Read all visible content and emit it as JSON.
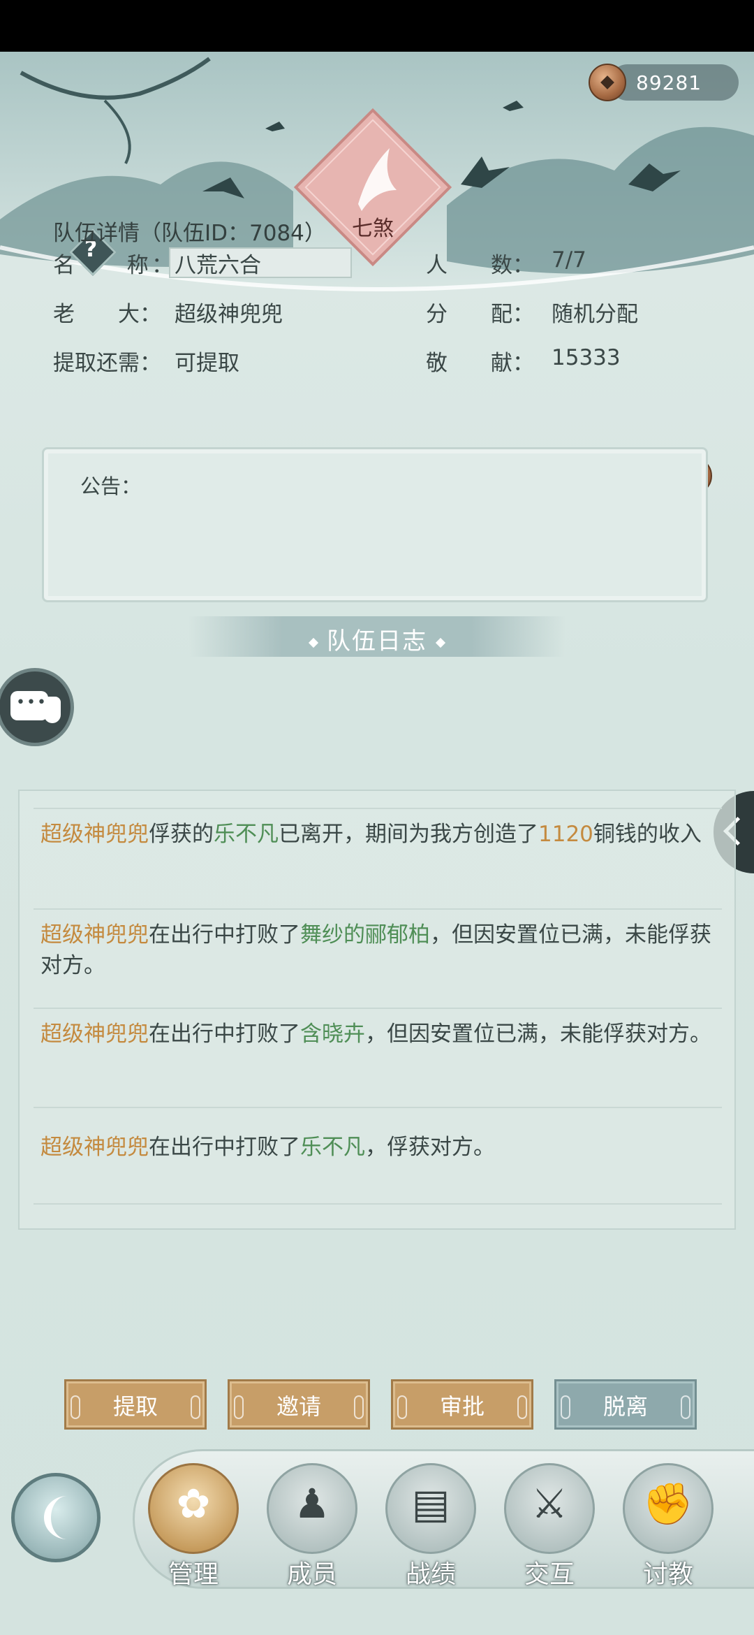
{
  "currency": {
    "icon": "copper-coin-icon",
    "amount": "89281"
  },
  "emblem": {
    "label": "七煞",
    "icon": "flower-emblem-icon"
  },
  "help": {
    "symbol": "?"
  },
  "team": {
    "title": "队伍详情（队伍ID：7084）",
    "name_label": "名　　称：",
    "name_value": "八荒六合",
    "members_label": "人　　数：",
    "members_value": "7/7",
    "leader_label": "老　　大：",
    "leader_value": "超级神兜兜",
    "distribution_label": "分　　配：",
    "distribution_value": "随机分配",
    "withdraw_label": "提取还需：",
    "withdraw_value": "可提取",
    "contribution_label": "敬　　献：",
    "contribution_value": "15333"
  },
  "notice": {
    "label": "公告："
  },
  "log": {
    "title": "队伍日志",
    "entries": [
      {
        "p1": "超级神兜兜",
        "p2": "俘获的",
        "p3": "乐不凡",
        "p4": "已离开，期间为我方创造了",
        "p5": "1120",
        "p6": "铜钱的收入"
      },
      {
        "p1": "超级神兜兜",
        "p2": "在出行中打败了",
        "p3": "舞纱的郦郁柏",
        "p4": "，但因安置位已满，未能俘获对方。"
      },
      {
        "p1": "超级神兜兜",
        "p2": "在出行中打败了",
        "p3": "含晓卉",
        "p4": "，但因安置位已满，未能俘获对方。"
      },
      {
        "p1": "超级神兜兜",
        "p2": "在出行中打败了",
        "p3": "乐不凡",
        "p4": "，俘获对方。"
      }
    ]
  },
  "buttons": {
    "withdraw": "提取",
    "invite": "邀请",
    "approve": "审批",
    "leave": "脱离"
  },
  "nav": {
    "manage": "管理",
    "members": "成员",
    "record": "战绩",
    "interact": "交互",
    "teach": "讨教"
  },
  "colors": {
    "orange_name": "#c48a3f",
    "green_name": "#4f8e56",
    "gold_button": "#c79e68",
    "teal_button": "#8ea9ac"
  }
}
